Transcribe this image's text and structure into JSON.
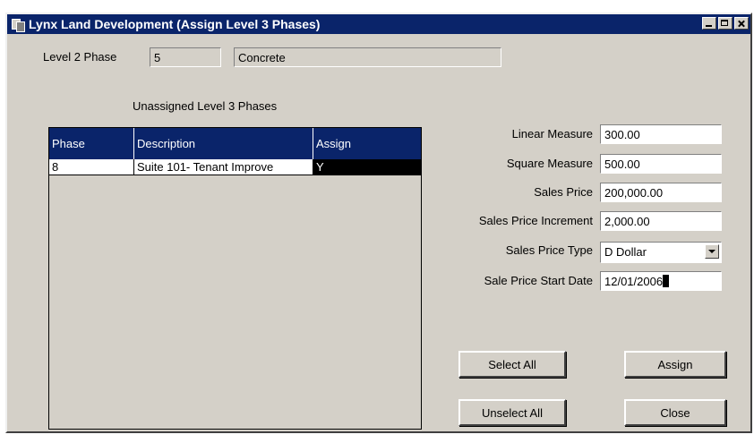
{
  "window": {
    "title": "Lynx Land Development (Assign Level 3 Phases)"
  },
  "level2": {
    "label": "Level 2 Phase",
    "code": "5",
    "description": "Concrete"
  },
  "unassigned": {
    "title": "Unassigned Level 3 Phases",
    "columns": [
      "Phase",
      "Description",
      "Assign"
    ],
    "rows": [
      {
        "phase": "8",
        "description": "Suite 101- Tenant Improve",
        "assign": "Y"
      }
    ]
  },
  "form": {
    "linear_measure": {
      "label": "Linear Measure",
      "value": "300.00"
    },
    "square_measure": {
      "label": "Square Measure",
      "value": "500.00"
    },
    "sales_price": {
      "label": "Sales Price",
      "value": "200,000.00"
    },
    "sales_price_increment": {
      "label": "Sales Price Increment",
      "value": "2,000.00"
    },
    "sales_price_type": {
      "label": "Sales Price Type",
      "value": "D Dollar"
    },
    "sale_price_start_date": {
      "label": "Sale Price Start Date",
      "value": "12/01/2006"
    }
  },
  "buttons": {
    "select_all": "Select All",
    "assign": "Assign",
    "unselect_all": "Unselect All",
    "close": "Close"
  },
  "colors": {
    "title_bar": "#0a246a",
    "window_bg": "#d4d0c8",
    "selected_cell": "#000000"
  }
}
